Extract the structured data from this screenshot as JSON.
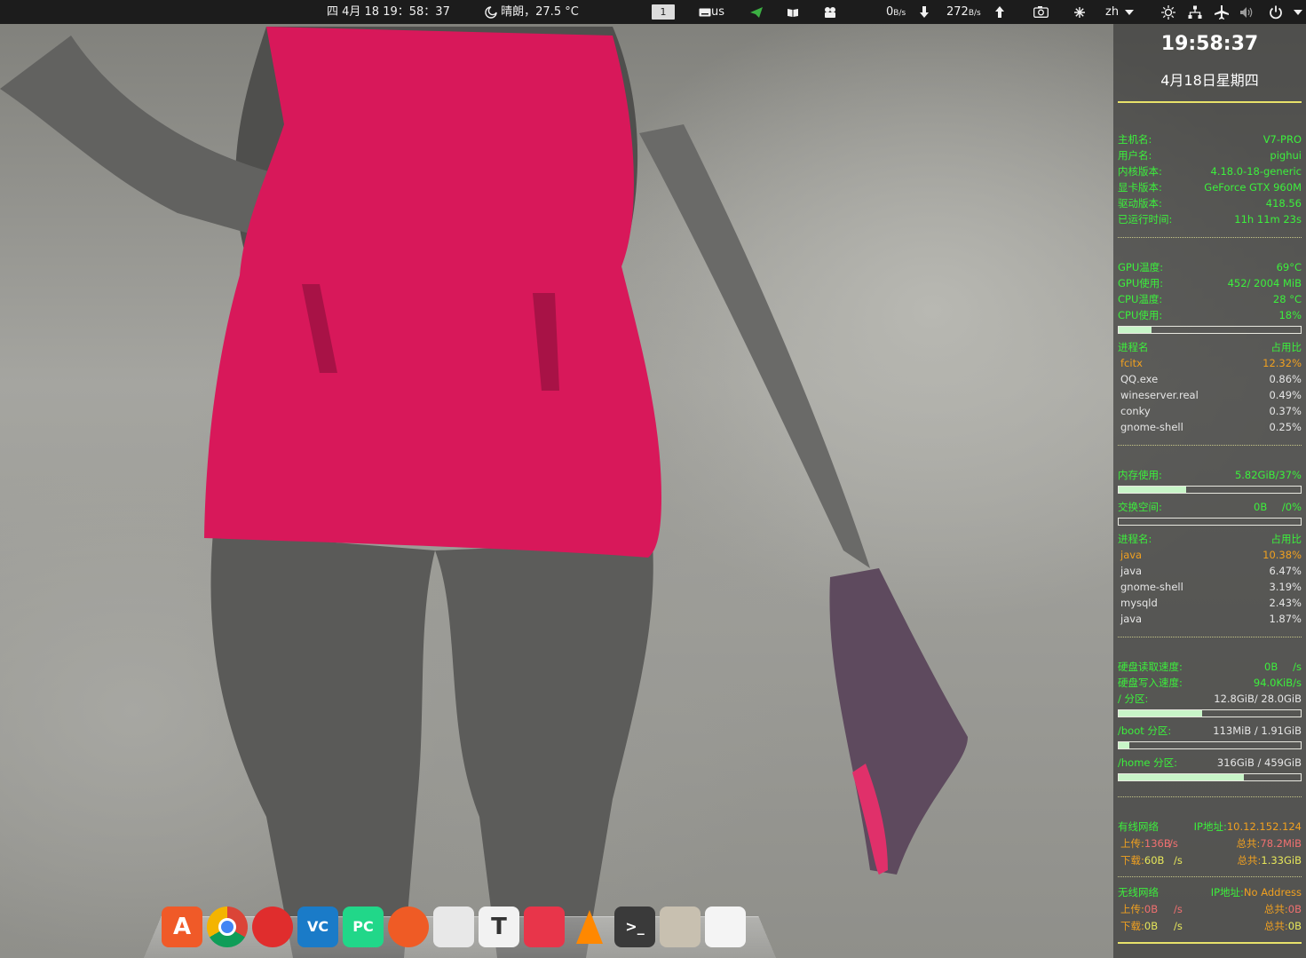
{
  "topbar": {
    "datetime": "四 4月 18  19：58：37",
    "weather": "晴朗，27.5 °C",
    "workspace": "1",
    "keyboard": "us",
    "net_down_value": "0",
    "net_down_unit": "B/s",
    "net_up_value": "272",
    "net_up_unit": "B/s",
    "lang": "zh",
    "icons": [
      "weather-icon",
      "keyboard-icon",
      "telegram-icon",
      "reader-icon",
      "camera-app-icon",
      "down-arrow-icon",
      "up-arrow-icon",
      "screenshot-icon",
      "snowflake-icon",
      "brightness-icon",
      "network-icon",
      "airplane-icon",
      "volume-icon",
      "power-icon"
    ]
  },
  "conky": {
    "time": "19:58:37",
    "date": "4月18日星期四",
    "system": [
      {
        "label": "主机名:",
        "value": "V7-PRO"
      },
      {
        "label": "用户名:",
        "value": "pighui"
      },
      {
        "label": "内核版本:",
        "value": "4.18.0-18-generic"
      },
      {
        "label": "显卡版本:",
        "value": "GeForce GTX 960M"
      },
      {
        "label": "驱动版本:",
        "value": "418.56"
      },
      {
        "label": "已运行时间:",
        "value": "11h 11m 23s"
      }
    ],
    "hw": [
      {
        "label": "GPU温度:",
        "value": "69°C"
      },
      {
        "label": "GPU使用:",
        "value": "452/ 2004 MiB"
      },
      {
        "label": "CPU温度:",
        "value": "28 °C"
      },
      {
        "label": "CPU使用:",
        "value": "18%"
      }
    ],
    "cpu_usage_fraction": 0.18,
    "cpu_proc_header": {
      "name": "进程名",
      "pct": "占用比"
    },
    "cpu_procs": [
      {
        "name": "fcitx",
        "pct": "12.32%"
      },
      {
        "name": "QQ.exe",
        "pct": "0.86%"
      },
      {
        "name": "wineserver.real",
        "pct": "0.49%"
      },
      {
        "name": "conky",
        "pct": "0.37%"
      },
      {
        "name": "gnome-shell",
        "pct": "0.25%"
      }
    ],
    "mem": {
      "label": "内存使用:",
      "value": "5.82GiB/37%",
      "fraction": 0.37
    },
    "swap": {
      "label": "交换空间:",
      "value1": "0B",
      "value2": "/0%",
      "fraction": 0.0
    },
    "mem_proc_header": {
      "name": "进程名:",
      "pct": "占用比"
    },
    "mem_procs": [
      {
        "name": "java",
        "pct": "10.38%"
      },
      {
        "name": "java",
        "pct": "6.47%"
      },
      {
        "name": "gnome-shell",
        "pct": "3.19%"
      },
      {
        "name": "mysqld",
        "pct": "2.43%"
      },
      {
        "name": "java",
        "pct": "1.87%"
      }
    ],
    "disk": {
      "read_label": "硬盘读取速度:",
      "read_value": "0B",
      "read_unit": "/s",
      "write_label": "硬盘写入速度:",
      "write_value": "94.0KiB/s",
      "root_label": "/ 分区:",
      "root_value": "12.8GiB/ 28.0GiB",
      "root_fraction": 0.457,
      "boot_label": "/boot 分区:",
      "boot_value": "113MiB / 1.91GiB",
      "boot_fraction": 0.058,
      "home_label": "/home 分区:",
      "home_value": "316GiB / 459GiB",
      "home_fraction": 0.688
    },
    "wired": {
      "title": "有线网络",
      "ip_label": "IP地址:",
      "ip": "10.12.152.124",
      "up_label": "上传:",
      "up": "136B",
      "up_unit": "/s",
      "up_total_label": "总共:",
      "up_total": "78.2MiB",
      "down_label": "下载:",
      "down": "60B",
      "down_unit": "/s",
      "down_total_label": "总共:",
      "down_total": "1.33GiB"
    },
    "wireless": {
      "title": "无线网络",
      "ip_label": "IP地址:",
      "ip": "No Address",
      "up_label": "上传:",
      "up": "0B",
      "up_unit": "/s",
      "up_total_label": "总共:",
      "up_total": "0B",
      "down_label": "下载:",
      "down": "0B",
      "down_unit": "/s",
      "down_total_label": "总共:",
      "down_total": "0B"
    }
  },
  "dock": {
    "apps": [
      {
        "name": "app-store",
        "glyph": "A",
        "color": "#f05a28"
      },
      {
        "name": "chrome",
        "glyph": "",
        "color": "#ffffff"
      },
      {
        "name": "netease-music",
        "glyph": "",
        "color": "#e02d2d"
      },
      {
        "name": "vscode",
        "glyph": "VC",
        "color": "#1a7bc8"
      },
      {
        "name": "pycharm",
        "glyph": "PC",
        "color": "#21d789"
      },
      {
        "name": "postman",
        "glyph": "",
        "color": "#ef5b25"
      },
      {
        "name": "milk",
        "glyph": "",
        "color": "#e8e8e8"
      },
      {
        "name": "typora",
        "glyph": "T",
        "color": "#f2f2f2"
      },
      {
        "name": "xmind",
        "glyph": "",
        "color": "#e8354a"
      },
      {
        "name": "vlc",
        "glyph": "",
        "color": "#ff8800"
      },
      {
        "name": "terminal",
        "glyph": ">_",
        "color": "#3a3a3a"
      },
      {
        "name": "files",
        "glyph": "",
        "color": "#c8c0b0"
      },
      {
        "name": "text-editor",
        "glyph": "",
        "color": "#f4f4f4"
      }
    ]
  }
}
